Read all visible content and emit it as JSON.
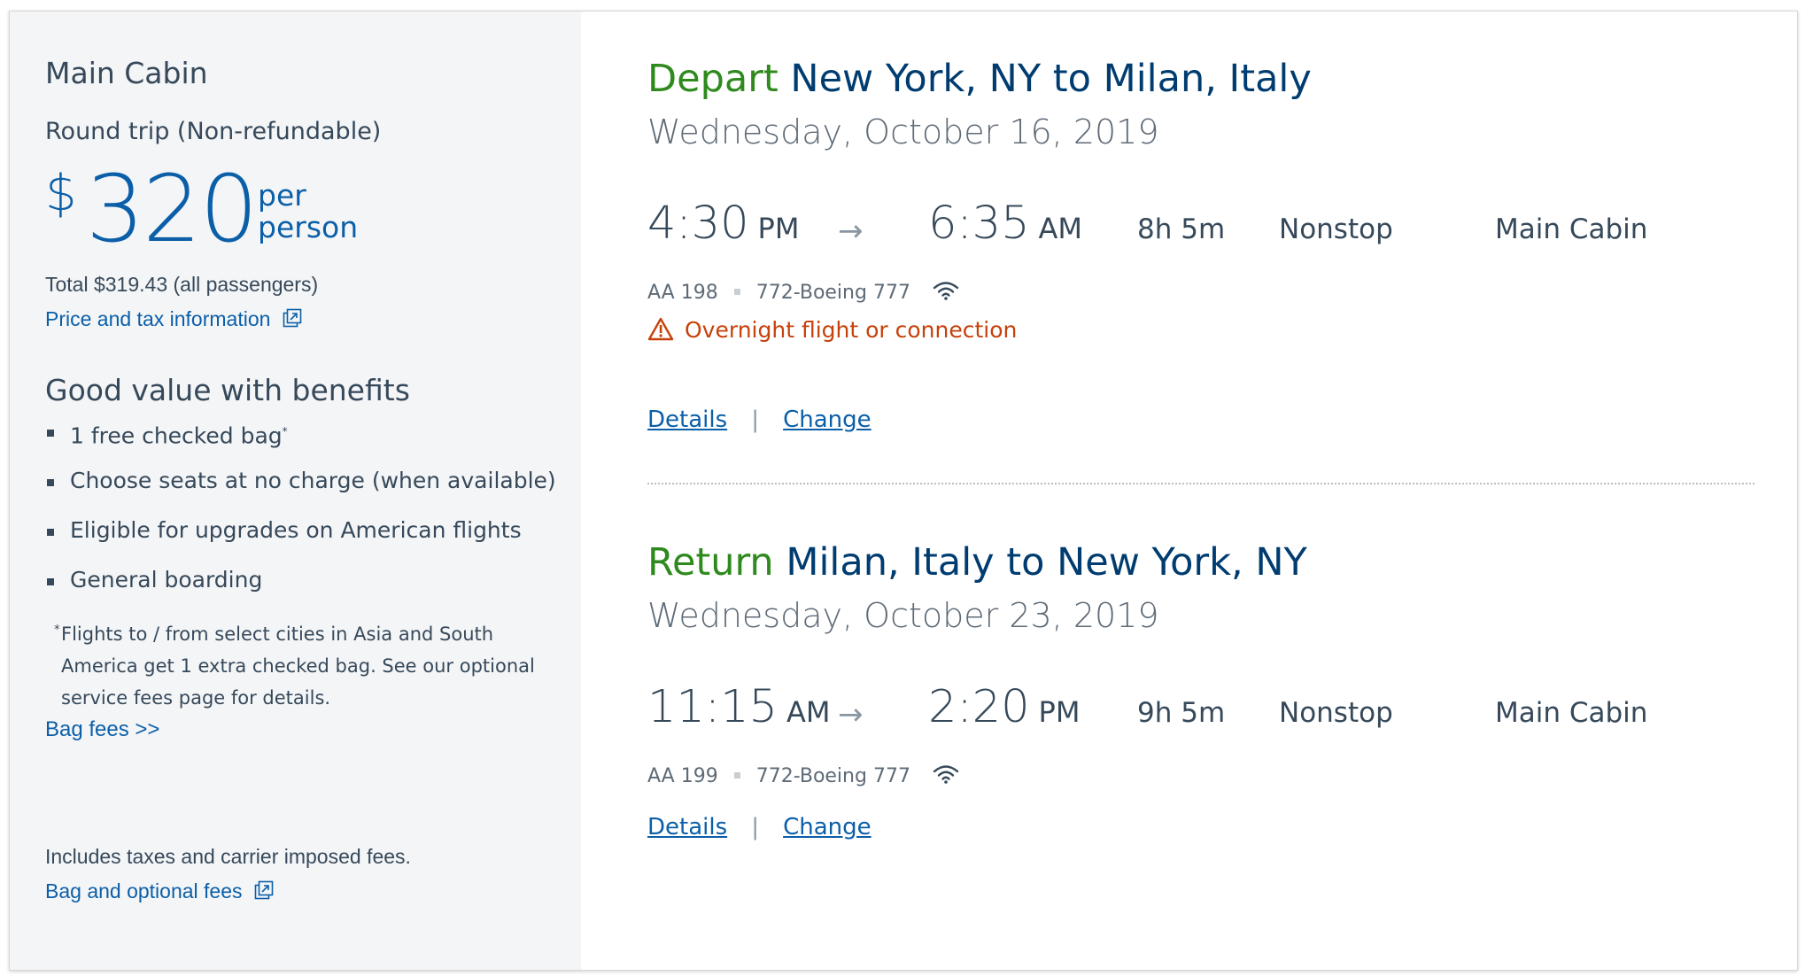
{
  "fare": {
    "cabin_title": "Main Cabin",
    "fare_type": "Round trip (Non-refundable)",
    "currency_symbol": "$",
    "amount": "320",
    "per_label_1": "per",
    "per_label_2": "person",
    "total": "Total $319.43 (all passengers)",
    "price_tax_link": "Price and tax information"
  },
  "benefits": {
    "title": "Good value with benefits",
    "items": [
      "1 free checked bag",
      "Choose seats at no charge (when available)",
      "Eligible for upgrades on American flights",
      "General boarding"
    ],
    "item_marker": "*",
    "footnote_marker": "*",
    "footnote": "Flights to / from select cities in Asia and South America get 1 extra checked bag. See our optional service fees page for details.",
    "bag_fees_link": "Bag fees >>"
  },
  "fees": {
    "includes_text": "Includes taxes and carrier imposed fees.",
    "bag_optional_link": "Bag and optional fees"
  },
  "depart": {
    "direction": "Depart",
    "route": "New York, NY to Milan, Italy",
    "date": "Wednesday, October 16, 2019",
    "dep_time": "4:30",
    "dep_ampm": "PM",
    "arrow": "→",
    "arr_time": "6:35",
    "arr_ampm": "AM",
    "duration": "8h  5m",
    "stops": "Nonstop",
    "cabin": "Main Cabin",
    "flight_number": "AA 198",
    "aircraft": "772-Boeing 777",
    "warning": "Overnight flight or connection",
    "details_link": "Details",
    "separator": "|",
    "change_link": "Change"
  },
  "return": {
    "direction": "Return",
    "route": "Milan, Italy to New York, NY",
    "date": "Wednesday, October 23, 2019",
    "dep_time": "11:15",
    "dep_ampm": "AM",
    "arrow": "→",
    "arr_time": "2:20",
    "arr_ampm": "PM",
    "duration": "9h  5m",
    "stops": "Nonstop",
    "cabin": "Main Cabin",
    "flight_number": "AA 199",
    "aircraft": "772-Boeing 777",
    "details_link": "Details",
    "separator": "|",
    "change_link": "Change"
  },
  "colors": {
    "brand_blue": "#0b5fa8",
    "route_navy": "#003c70",
    "direction_green": "#2f8a1d",
    "warning_orange": "#c7410a",
    "panel_bg": "#f4f5f7"
  },
  "icons": {
    "external_link": "external-link-icon",
    "wifi": "wifi-icon",
    "warning": "warning-triangle-icon"
  }
}
